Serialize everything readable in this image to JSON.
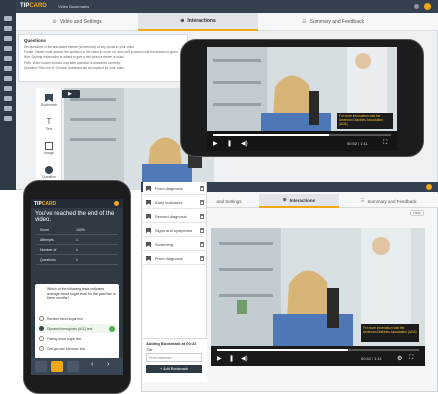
{
  "desktop": {
    "logo_main": "TIP",
    "logo_accent": "CARD",
    "page_title": "Video Bookmarks",
    "tabs": [
      {
        "label": "Video and Settings"
      },
      {
        "label": "Interactions"
      },
      {
        "label": "Summary and Feedback"
      }
    ],
    "questions": {
      "title": "Questions",
      "lines": [
        "Set questions in the annotated frames (screenshot) at key points in your video.",
        "Pause: Viewer must answer the question in the video to move on, and can't proceed until the answer is given.",
        "Hint: Scoring Information is added to give a hint when a viewer is stuck.",
        "Path: Video moves forward only after question is answered correctly.",
        "Question: Pick one of 'Choose' questions set as required for your video."
      ]
    },
    "tools": [
      {
        "label": "Bookmark"
      },
      {
        "label": "Text"
      },
      {
        "label": "Image"
      },
      {
        "label": "Question"
      }
    ],
    "accent": "#f3a712",
    "sidebar_color": "#2e3a46"
  },
  "video": {
    "caption_title": "For more information visit the American Diabetes Association (ADA)",
    "time": "00:52 / 1:11",
    "progress": 0.65
  },
  "tablet": {
    "tabs": [
      {
        "label": "and Settings"
      },
      {
        "label": "Interactions"
      },
      {
        "label": "Summary and Feedback"
      }
    ],
    "help": "Help",
    "bookmarks": [
      {
        "label": "Prom diagnosis"
      },
      {
        "label": "Early indicators"
      },
      {
        "label": "Second diagnosis"
      },
      {
        "label": "Signs and symptoms"
      },
      {
        "label": "Screening"
      },
      {
        "label": "Prom diagnosis"
      }
    ],
    "add_bookmark": {
      "heading": "Adding Bookmark at 00:22",
      "title_label": "Title",
      "title_value": "Prom diabetes",
      "button": "+ Add Bookmark"
    }
  },
  "phone_portrait": {
    "logo_main": "TIP",
    "logo_accent": "CARD",
    "end_title": "You've reached the end of the video.",
    "stats": [
      {
        "label": "Score",
        "value": "100%"
      },
      {
        "label": "Attempts",
        "value": "1"
      },
      {
        "label": "Number of",
        "value": "1"
      },
      {
        "label": "Questions",
        "value": "1"
      }
    ],
    "question": "Which of the following tests indicates average blood sugar level for the past two to three months?",
    "options": [
      {
        "label": "Random blood sugar test",
        "selected": false
      },
      {
        "label": "Glycated hemoglobin (A1C) test",
        "selected": true
      },
      {
        "label": "Fasting blood sugar test",
        "selected": false
      },
      {
        "label": "Oral glucose tolerance test",
        "selected": false
      }
    ]
  }
}
